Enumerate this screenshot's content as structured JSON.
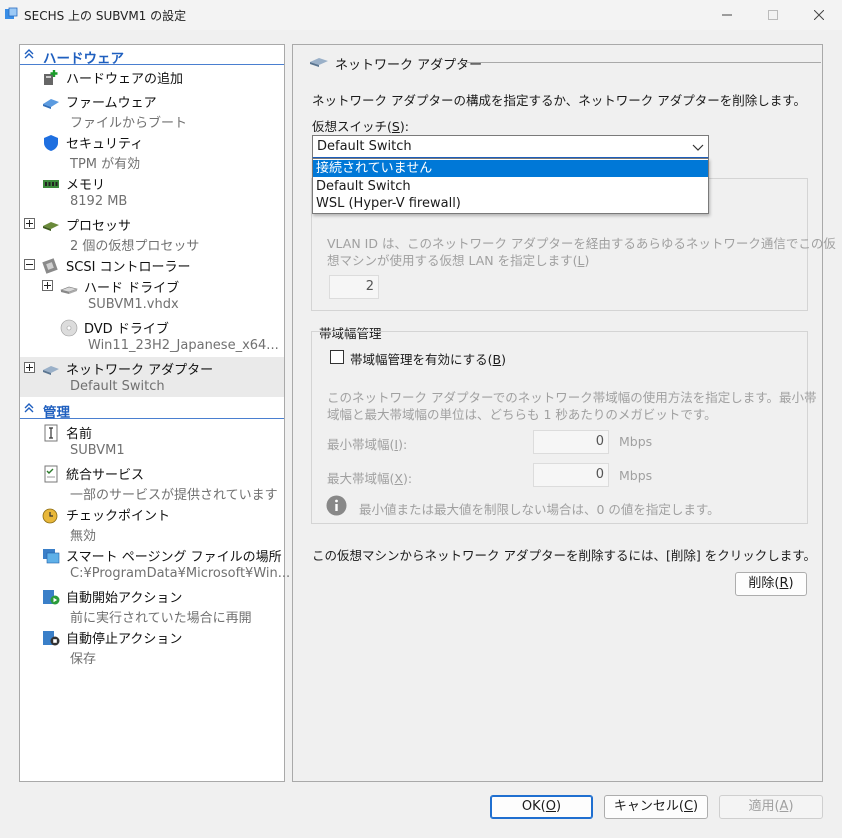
{
  "window": {
    "title": "SECHS 上の SUBVM1 の設定"
  },
  "tree": {
    "hardware_header": "ハードウェア",
    "management_header": "管理",
    "hardware_items": [
      {
        "name": "ハードウェアの追加",
        "sub": "",
        "icon": "add-hardware-icon"
      },
      {
        "name": "ファームウェア",
        "sub": "ファイルからブート",
        "icon": "firmware-icon"
      },
      {
        "name": "セキュリティ",
        "sub": "TPM が有効",
        "icon": "shield-icon"
      },
      {
        "name": "メモリ",
        "sub": "8192 MB",
        "icon": "memory-icon"
      },
      {
        "name": "プロセッサ",
        "sub": "2 個の仮想プロセッサ",
        "icon": "processor-icon"
      },
      {
        "name": "SCSI コントローラー",
        "sub": "",
        "icon": "scsi-controller-icon"
      },
      {
        "name": "ハード ドライブ",
        "sub": "SUBVM1.vhdx",
        "icon": "hard-drive-icon"
      },
      {
        "name": "DVD ドライブ",
        "sub": "Win11_23H2_Japanese_x64...",
        "icon": "dvd-drive-icon"
      },
      {
        "name": "ネットワーク アダプター",
        "sub": "Default Switch",
        "icon": "network-adapter-icon"
      }
    ],
    "management_items": [
      {
        "name": "名前",
        "sub": "SUBVM1",
        "icon": "name-icon"
      },
      {
        "name": "統合サービス",
        "sub": "一部のサービスが提供されています",
        "icon": "integration-services-icon"
      },
      {
        "name": "チェックポイント",
        "sub": "無効",
        "icon": "checkpoint-icon"
      },
      {
        "name": "スマート ページング ファイルの場所",
        "sub": "C:¥ProgramData¥Microsoft¥Win...",
        "icon": "smart-paging-icon"
      },
      {
        "name": "自動開始アクション",
        "sub": "前に実行されていた場合に再開",
        "icon": "auto-start-icon"
      },
      {
        "name": "自動停止アクション",
        "sub": "保存",
        "icon": "auto-stop-icon"
      }
    ]
  },
  "pane": {
    "header": "ネットワーク アダプター",
    "description": "ネットワーク アダプターの構成を指定するか、ネットワーク アダプターを削除します。",
    "switch_label": "仮想スイッチ(",
    "switch_key": "S",
    "switch_label_end": "):",
    "switch_value": "Default Switch",
    "switch_options": [
      "接続されていません",
      "Default Switch",
      "WSL (Hyper-V firewall)"
    ],
    "vlan_text_1": "VLAN ID は、このネットワーク アダプターを経由するあらゆるネットワーク通信でこの仮",
    "vlan_text_2": "想マシンが使用する仮想 LAN を指定します(",
    "vlan_key": "L",
    "vlan_text_end": ")",
    "vlan_value": "2",
    "bandwidth_header": "帯域幅管理",
    "bandwidth_check_label": "帯域幅管理を有効にする(",
    "bandwidth_check_key": "B",
    "bandwidth_check_end": ")",
    "bandwidth_desc_1": "このネットワーク アダプターでのネットワーク帯域幅の使用方法を指定します。最小帯",
    "bandwidth_desc_2": "域幅と最大帯域幅の単位は、どちらも 1 秒あたりのメガビットです。",
    "min_label": "最小帯域幅(",
    "min_key": "I",
    "min_end": "):",
    "min_value": "0",
    "max_label": "最大帯域幅(",
    "max_key": "X",
    "max_end": "):",
    "max_value": "0",
    "unit": "Mbps",
    "info_text": "最小値または最大値を制限しない場合は、0 の値を指定します。",
    "remove_text": "この仮想マシンからネットワーク アダプターを削除するには、[削除] をクリックします。",
    "remove_label": "削除(",
    "remove_key": "R",
    "remove_end": ")"
  },
  "buttons": {
    "ok_label": "OK(",
    "ok_key": "O",
    "ok_end": ")",
    "cancel_label": "キャンセル(",
    "cancel_key": "C",
    "cancel_end": ")",
    "apply_label": "適用(",
    "apply_key": "A",
    "apply_end": ")"
  },
  "colors": {
    "accent": "#1f5fbf",
    "highlight": "#0078d7"
  }
}
